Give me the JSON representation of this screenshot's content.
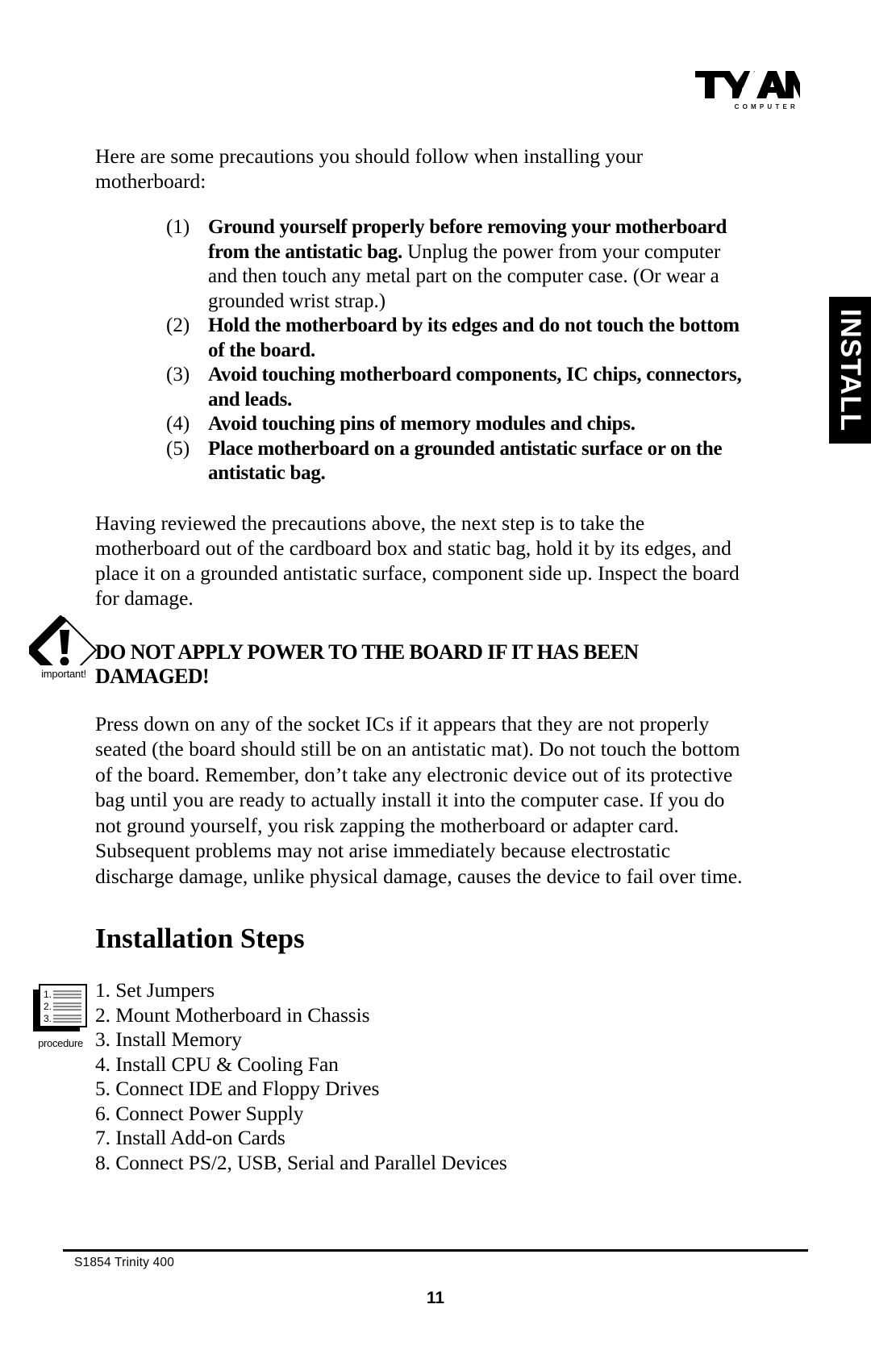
{
  "logo": {
    "wordmark": "TYAN",
    "subtext": "COMPUTER"
  },
  "side_tab": {
    "label": "INSTALL"
  },
  "content": {
    "intro_paragraph": "Here are some precautions you should follow when installing your motherboard:",
    "precautions": [
      {
        "number": "(1)",
        "bold": "Ground yourself properly before removing your motherboard from the antistatic bag.",
        "rest": " Unplug the power from your computer and then touch any metal part on the computer case.  (Or wear a grounded wrist strap.)"
      },
      {
        "number": "(2)",
        "bold": "Hold the motherboard by its edges and do not touch the bottom of the board.",
        "rest": ""
      },
      {
        "number": "(3)",
        "bold": "Avoid touching motherboard components, IC chips, connectors, and leads.",
        "rest": ""
      },
      {
        "number": "(4)",
        "bold": "Avoid touching pins of memory modules and chips.",
        "rest": ""
      },
      {
        "number": "(5)",
        "bold": "Place motherboard on a grounded antistatic surface or on the antistatic bag.",
        "rest": ""
      }
    ],
    "having_paragraph": "Having reviewed the precautions above, the next step is to take the motherboard out of the cardboard box and static bag, hold it by its edges, and place it on a grounded antistatic surface, component side up. Inspect the board for damage.",
    "warning": {
      "icon_caption": "important!",
      "text": "DO NOT APPLY POWER TO THE BOARD IF IT HAS BEEN DAMAGED!"
    },
    "press_paragraph": "Press down on any of the socket ICs if it appears that they are not properly seated (the board should still be on an antistatic mat). Do not touch the bottom of the board. Remember, don’t take any electronic device out of its protective bag until you are ready to actually install it into the computer case. If you do not ground yourself, you risk zapping the motherboard or adapter card. Subsequent problems may not arise immediately because electrostatic discharge damage, unlike physical damage, causes the device to fail over time.",
    "steps_heading": "Installation Steps",
    "procedure_icon_caption": "procedure",
    "procedure_icon_numbers": [
      "1.",
      "2.",
      "3."
    ],
    "steps": [
      "1. Set Jumpers",
      "2. Mount Motherboard in Chassis",
      "3. Install Memory",
      "4. Install CPU & Cooling Fan",
      "5. Connect IDE and Floppy Drives",
      "6. Connect Power Supply",
      "7. Install Add-on Cards",
      "8. Connect PS/2, USB, Serial and Parallel Devices"
    ]
  },
  "footer": {
    "model": "S1854  Trinity 400",
    "page_number": "11"
  }
}
